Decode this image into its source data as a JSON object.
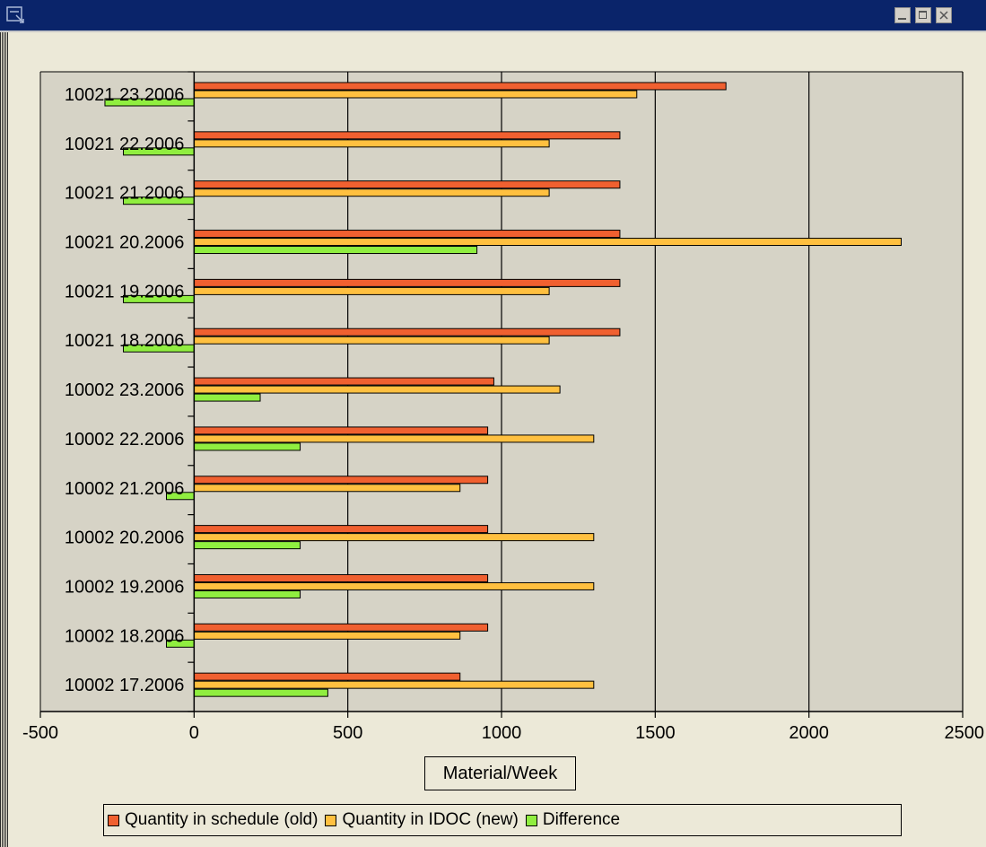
{
  "window": {
    "title": ""
  },
  "chart_data": {
    "type": "bar",
    "orientation": "horizontal",
    "categories": [
      "10021 23.2006",
      "10021 22.2006",
      "10021 21.2006",
      "10021 20.2006",
      "10021 19.2006",
      "10021 18.2006",
      "10002 23.2006",
      "10002 22.2006",
      "10002 21.2006",
      "10002 20.2006",
      "10002 19.2006",
      "10002 18.2006",
      "10002 17.2006"
    ],
    "series": [
      {
        "name": "Quantity in schedule (old)",
        "color": "#f06030",
        "values": [
          1730,
          1385,
          1385,
          1385,
          1385,
          1385,
          975,
          955,
          955,
          955,
          955,
          955,
          865
        ]
      },
      {
        "name": "Quantity in IDOC (new)",
        "color": "#ffc040",
        "values": [
          1440,
          1155,
          1155,
          2300,
          1155,
          1155,
          1190,
          1300,
          865,
          1300,
          1300,
          865,
          1300
        ]
      },
      {
        "name": "Difference",
        "color": "#90ee40",
        "values": [
          -290,
          -230,
          -230,
          920,
          -230,
          -230,
          215,
          345,
          -90,
          345,
          345,
          -90,
          435
        ]
      }
    ],
    "xlim": [
      -500,
      2500
    ],
    "xticks": [
      "-500",
      "0",
      "500",
      "1000",
      "1500",
      "2000",
      "2500"
    ],
    "xticks_values": [
      -500,
      0,
      500,
      1000,
      1500,
      2000,
      2500
    ],
    "xlabel": "Material/Week",
    "ylabel": "",
    "title": "",
    "grid": true,
    "legend_position": "bottom"
  }
}
